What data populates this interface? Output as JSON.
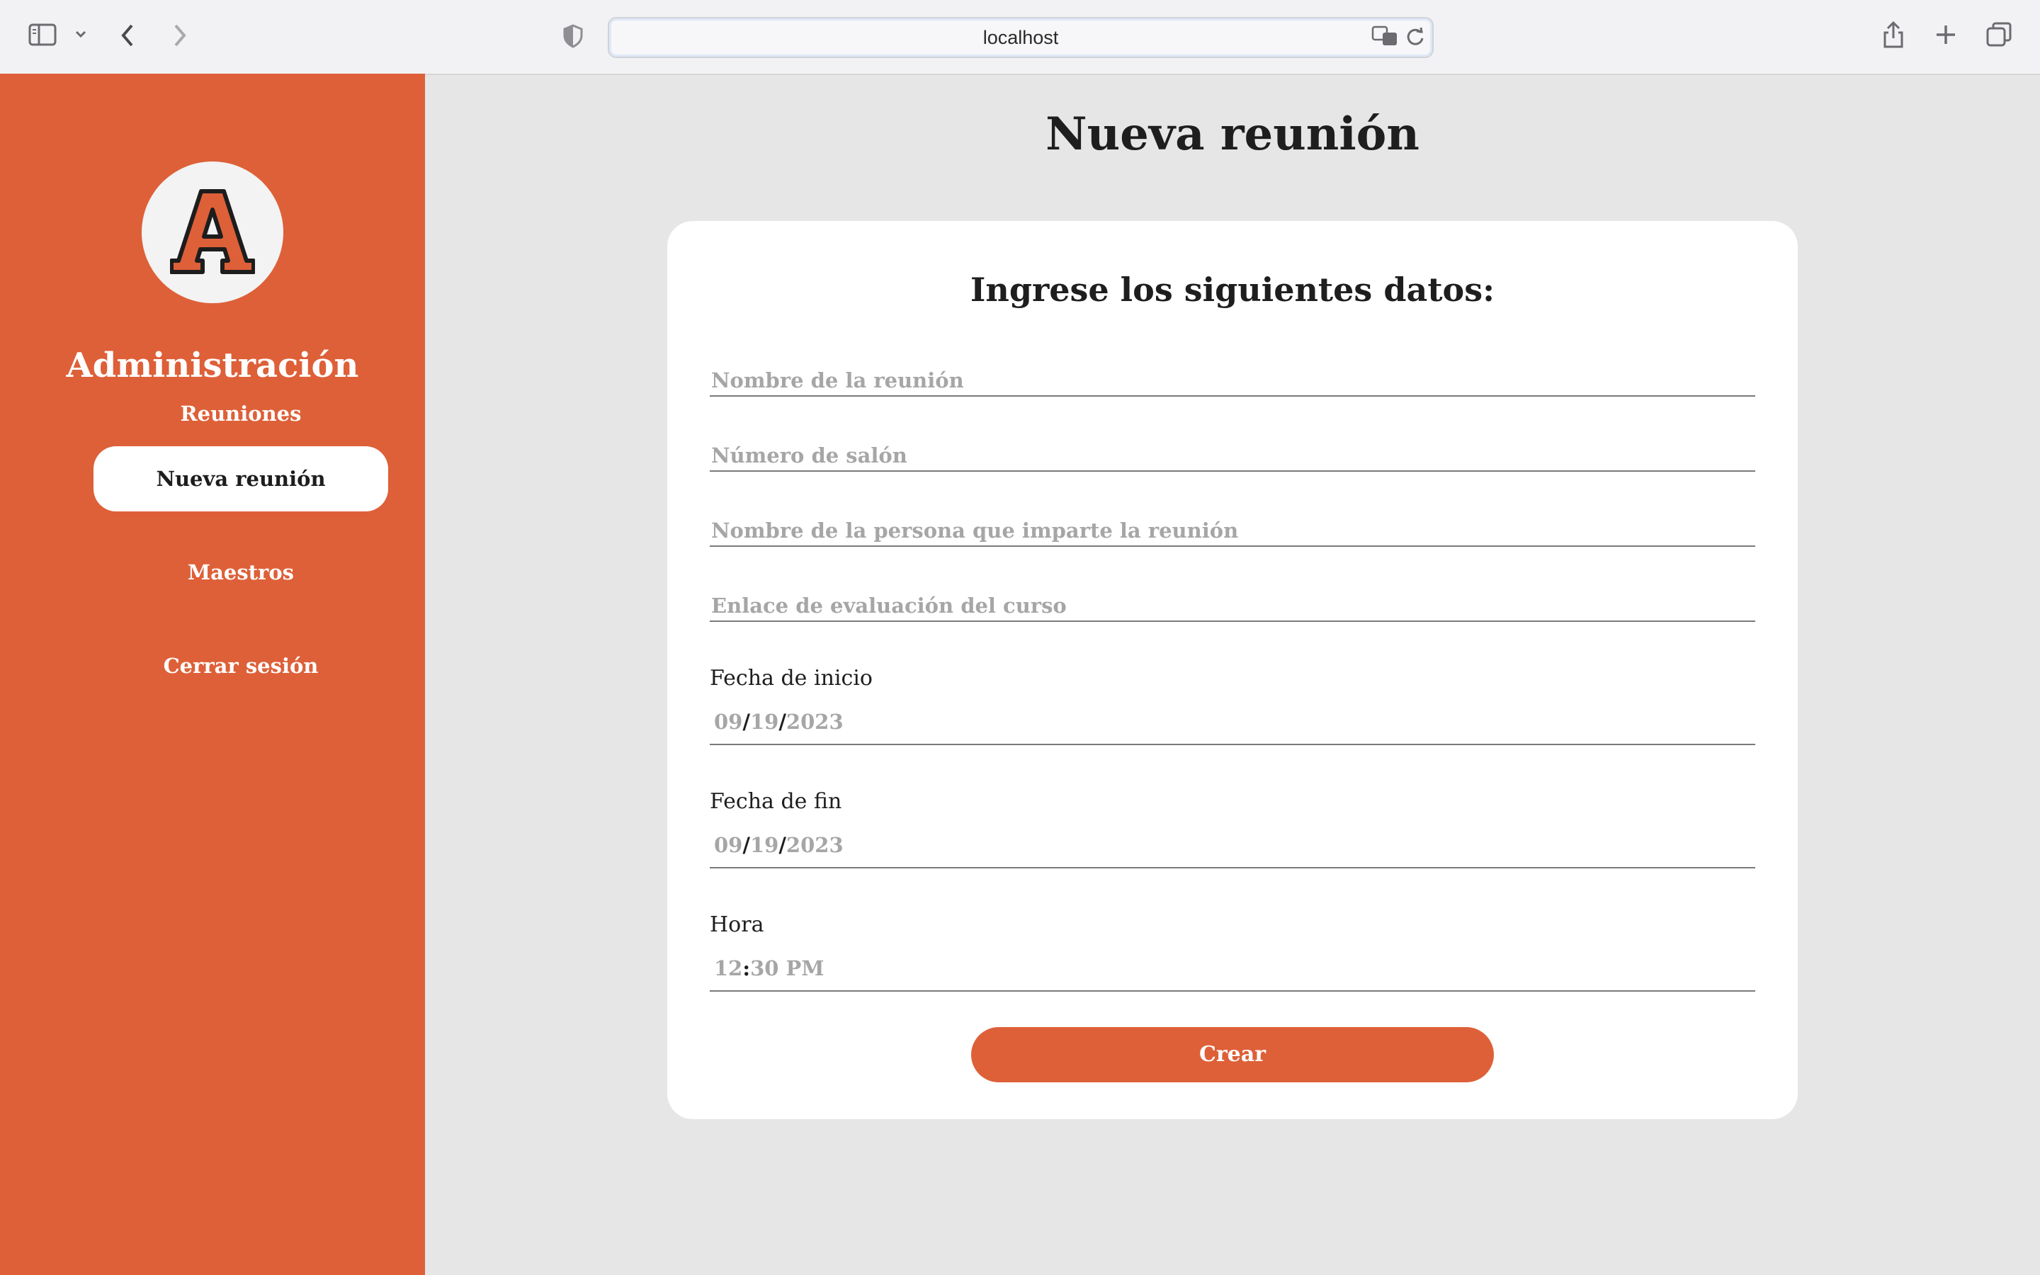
{
  "browser": {
    "url": "localhost"
  },
  "sidebar": {
    "logo_letter": "A",
    "title": "Administración",
    "items": [
      {
        "label": "Reuniones",
        "active": false
      },
      {
        "label": "Nueva reunión",
        "active": true
      },
      {
        "label": "Maestros",
        "active": false
      },
      {
        "label": "Cerrar sesión",
        "active": false
      }
    ]
  },
  "main": {
    "page_title": "Nueva reunión",
    "form": {
      "title": "Ingrese los siguientes datos:",
      "fields": {
        "meeting_name": {
          "placeholder": "Nombre de la reunión",
          "value": ""
        },
        "room_number": {
          "placeholder": "Número de salón",
          "value": ""
        },
        "host_name": {
          "placeholder": "Nombre de la persona que imparte la reunión",
          "value": ""
        },
        "eval_link": {
          "placeholder": "Enlace de evaluación del curso",
          "value": ""
        }
      },
      "start_date": {
        "label": "Fecha de inicio",
        "month": "09",
        "day": "19",
        "year": "2023"
      },
      "end_date": {
        "label": "Fecha de fin",
        "month": "09",
        "day": "19",
        "year": "2023"
      },
      "time": {
        "label": "Hora",
        "hour": "12",
        "minute": "30",
        "period": "PM"
      },
      "submit_label": "Crear"
    }
  },
  "colors": {
    "accent": "#de6038",
    "background": "#e6e6e6",
    "card": "#ffffff"
  }
}
